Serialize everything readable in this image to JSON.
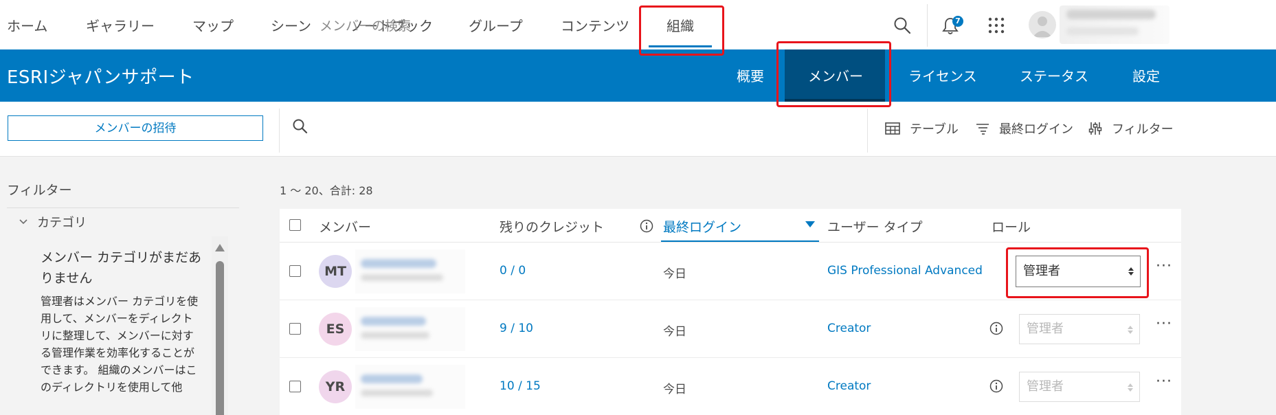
{
  "top_nav": {
    "items": [
      "ホーム",
      "ギャラリー",
      "マップ",
      "シーン",
      "ノートブック",
      "グループ",
      "コンテンツ",
      "組織"
    ],
    "active_item": "組織",
    "notification_count": "7"
  },
  "org_bar": {
    "org_name": "ESRIジャパンサポート",
    "tabs": [
      "概要",
      "メンバー",
      "ライセンス",
      "ステータス",
      "設定"
    ],
    "active_tab": "メンバー"
  },
  "toolbar": {
    "invite_label": "メンバーの招待",
    "search_placeholder": "メンバーの検索",
    "table_label": "テーブル",
    "sort_label": "最終ログイン",
    "filter_label": "フィルター"
  },
  "filters": {
    "title": "フィルター",
    "category_label": "カテゴリ",
    "empty_title": "メンバー カテゴリがまだありません",
    "empty_desc": "管理者はメンバー カテゴリを使用して、メンバーをディレクトリに整理して、メンバーに対する管理作業を効率化することができます。 組織のメンバーはこのディレクトリを使用して他"
  },
  "results": {
    "count_text": "1 ～ 20、合計: 28",
    "columns": {
      "member": "メンバー",
      "credits": "残りのクレジット",
      "last_login": "最終ログイン",
      "user_type": "ユーザー タイプ",
      "role": "ロール"
    },
    "rows": [
      {
        "initials": "MT",
        "avatar_color": "#dcd7f0",
        "credits": "0 / 0",
        "last_login": "今日",
        "user_type": "GIS Professional Advanced",
        "role": "管理者",
        "role_enabled": true
      },
      {
        "initials": "ES",
        "avatar_color": "#f3d6ea",
        "credits": "9 / 10",
        "last_login": "今日",
        "user_type": "Creator",
        "role": "管理者",
        "role_enabled": false
      },
      {
        "initials": "YR",
        "avatar_color": "#f0d6ec",
        "credits": "10 / 15",
        "last_login": "今日",
        "user_type": "Creator",
        "role": "管理者",
        "role_enabled": false
      }
    ]
  },
  "colors": {
    "brand_blue": "#0079c1",
    "active_tab_bg": "#004f80",
    "highlight_red": "#e8141b"
  },
  "icons": [
    "search-icon",
    "bell-icon",
    "app-launcher-icon",
    "user-avatar-icon",
    "table-icon",
    "sort-icon",
    "filter-sliders-icon",
    "chevron-down-icon",
    "info-icon",
    "more-icon"
  ]
}
